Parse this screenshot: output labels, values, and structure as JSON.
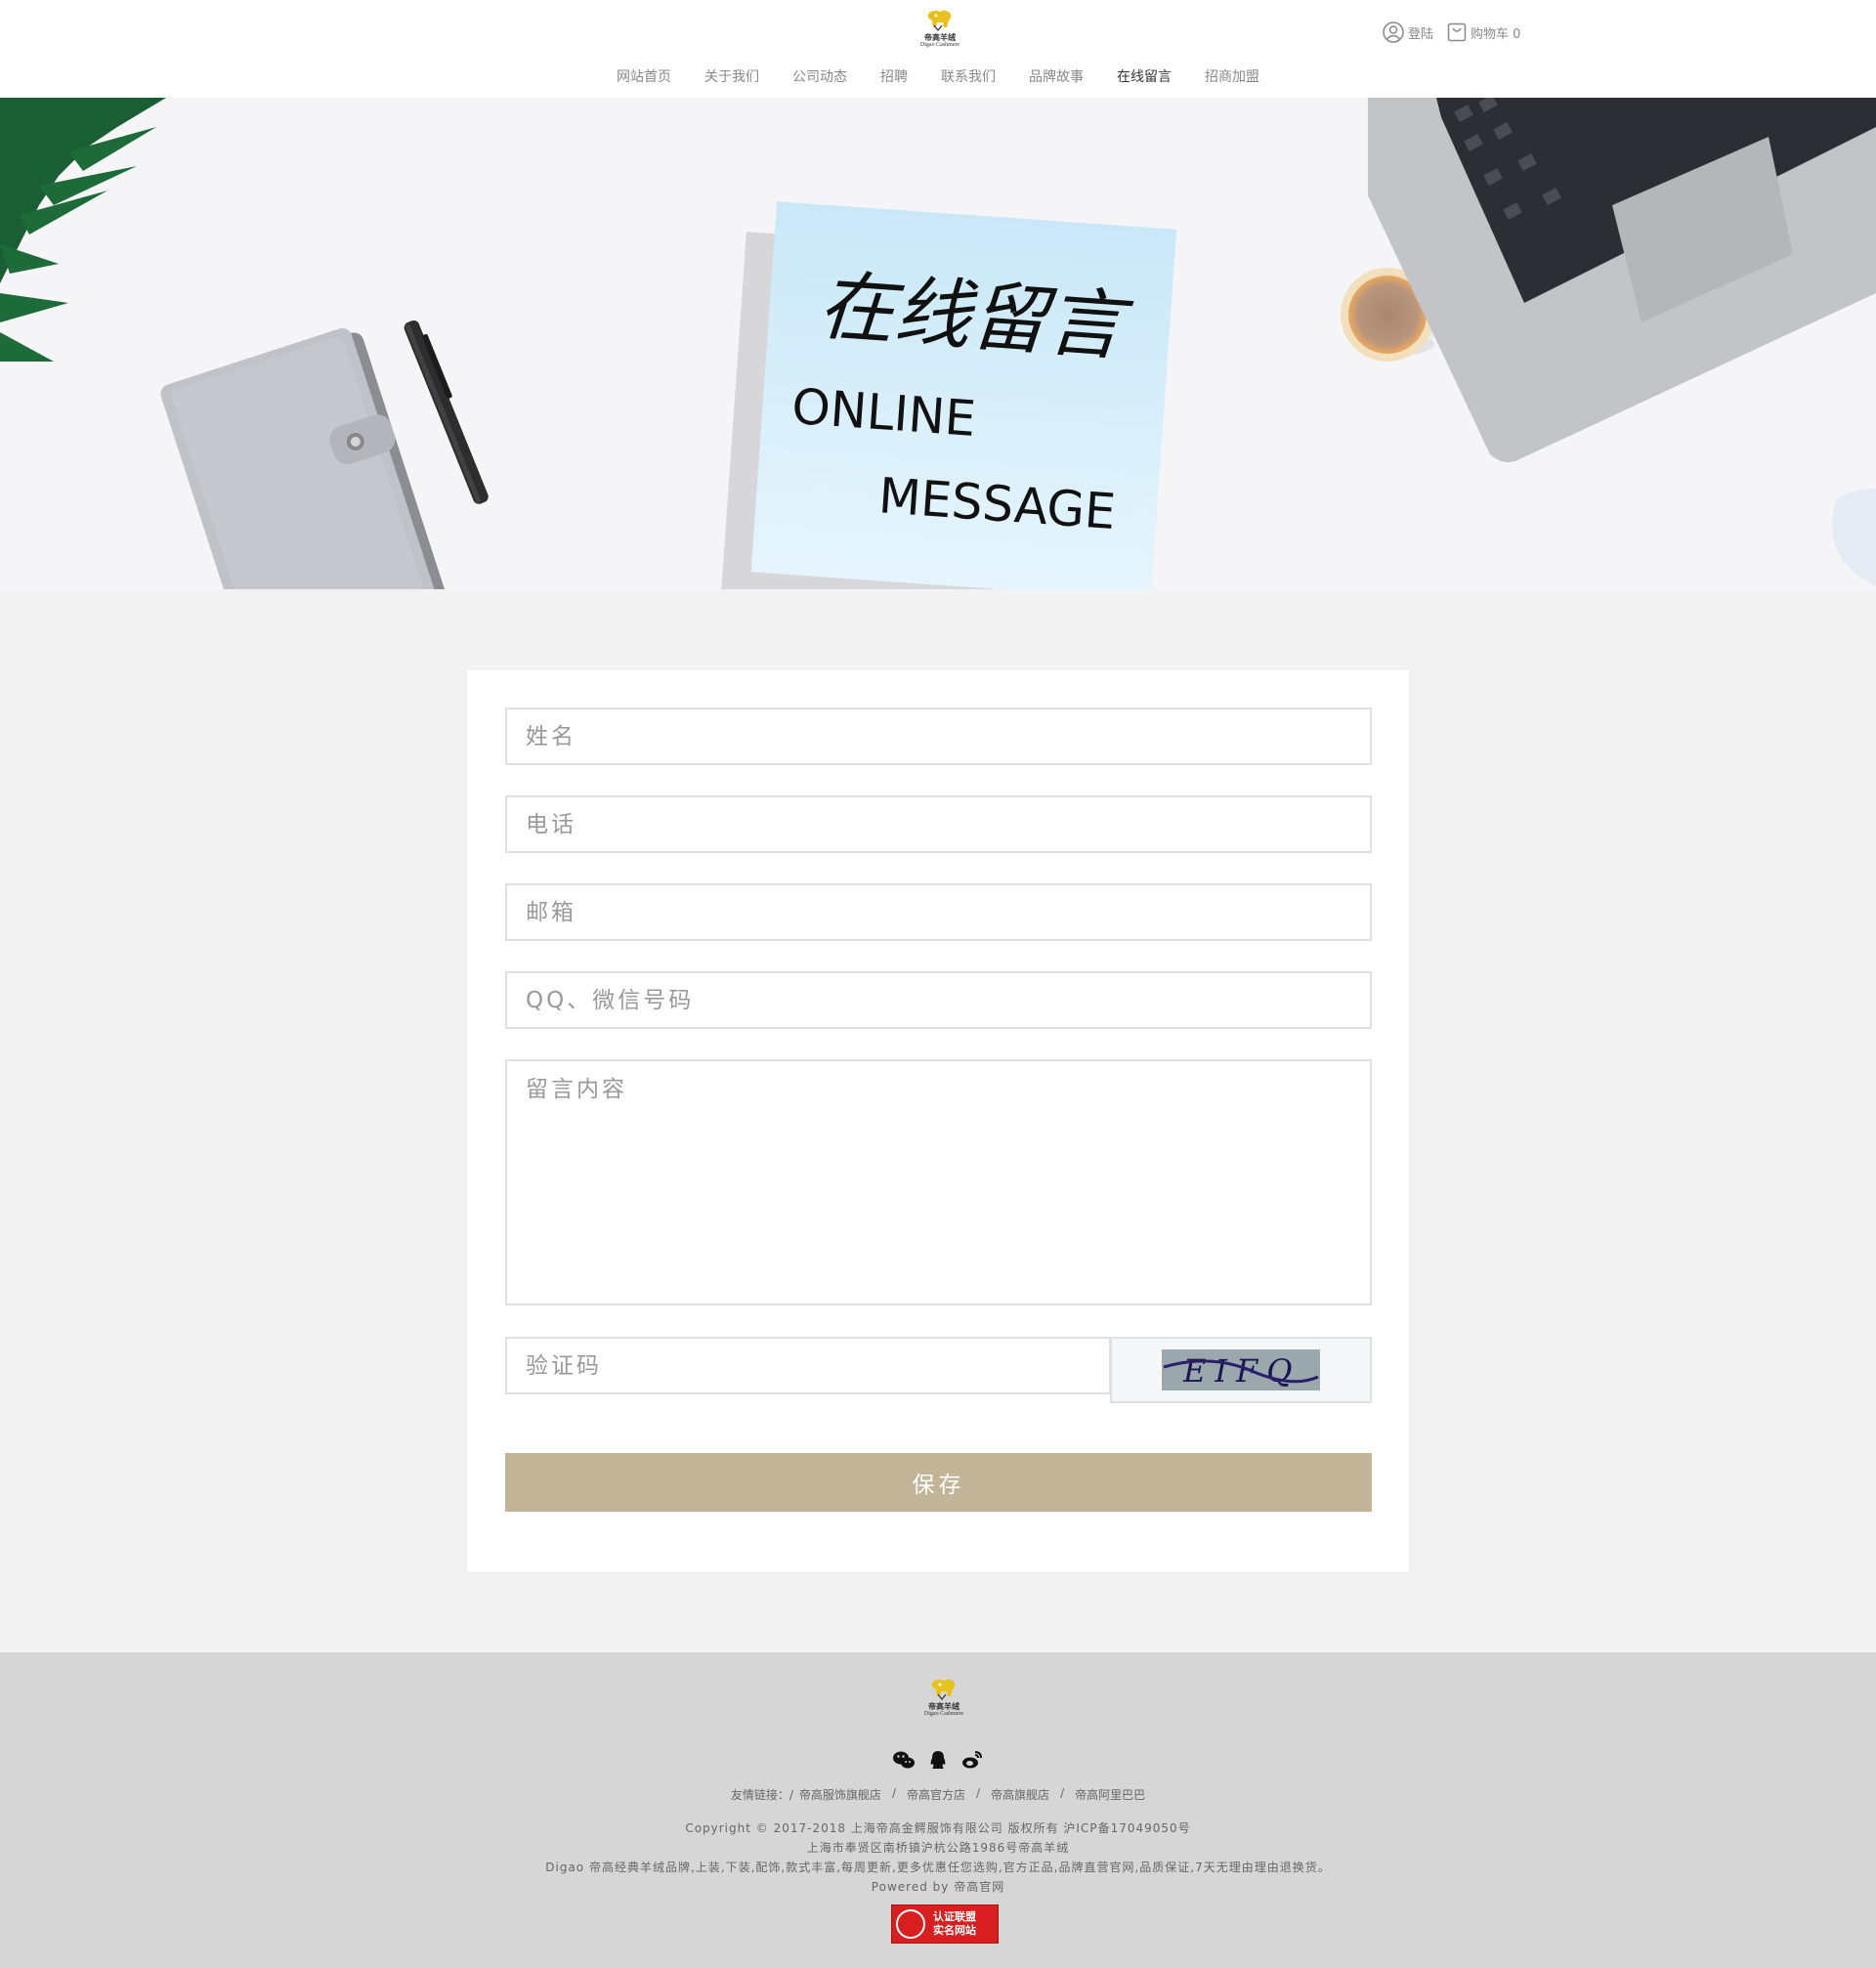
{
  "brand": {
    "name_cn": "帝高羊绒",
    "name_en": "Digao Cashmere"
  },
  "header": {
    "login_label": "登陆",
    "cart_label": "购物车 0"
  },
  "nav": {
    "items": [
      {
        "label": "网站首页"
      },
      {
        "label": "关于我们"
      },
      {
        "label": "公司动态"
      },
      {
        "label": "招聘"
      },
      {
        "label": "联系我们"
      },
      {
        "label": "品牌故事"
      },
      {
        "label": "在线留言",
        "active": true
      },
      {
        "label": "招商加盟"
      }
    ]
  },
  "banner": {
    "title_cn": "在线留言",
    "title_en_1": "ONLINE",
    "title_en_2": "MESSAGE"
  },
  "form": {
    "name_placeholder": "姓名",
    "phone_placeholder": "电话",
    "email_placeholder": "邮箱",
    "im_placeholder": "QQ、微信号码",
    "message_placeholder": "留言内容",
    "captcha_placeholder": "验证码",
    "captcha_text": "EIFQ",
    "save_label": "保存"
  },
  "footer": {
    "links_label": "友情链接：/",
    "links": [
      "帝高服饰旗舰店",
      "帝高官方店",
      "帝高旗舰店",
      "帝高阿里巴巴"
    ],
    "separator": "/",
    "copyright": "Copyright © 2017-2018 上海帝高金鳄服饰有限公司 版权所有 沪ICP备17049050号",
    "address": "上海市奉贤区南桥镇沪杭公路1986号帝高羊绒",
    "description": "Digao 帝高经典羊绒品牌,上装,下装,配饰,款式丰富,每周更新,更多优惠任您选购,官方正品,品牌直营官网,品质保证,7天无理由理由退换货。",
    "powered_prefix": "Powered by",
    "powered_link": "帝高官网",
    "cert_line1": "认证联盟",
    "cert_line2": "实名网站"
  },
  "colors": {
    "accent": "#c2b497",
    "footer_bg": "#d6d6d6",
    "page_bg": "#f2f2f2",
    "logo_yellow": "#e8c21a"
  }
}
